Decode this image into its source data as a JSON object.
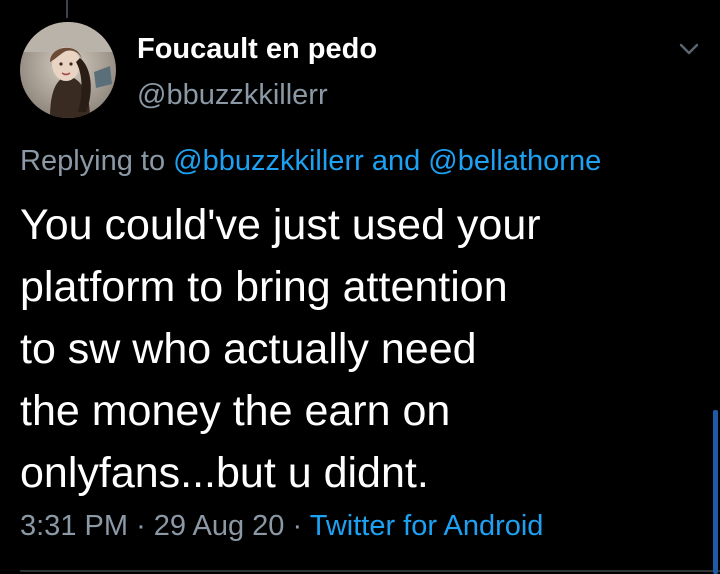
{
  "author": {
    "display_name": "Foucault en pedo",
    "handle": "@bbuzzkkillerr",
    "avatar": "profile-photo"
  },
  "menu_icon": "chevron-down-icon",
  "reply_context": {
    "prefix": "Replying to",
    "mention_1": "@bbuzzkkillerr",
    "joiner": "and",
    "mention_2": "@bellathorne"
  },
  "tweet": {
    "lines": [
      "You could've just used your",
      "platform to bring attention",
      "to sw who actually need",
      "the money the earn on",
      "onlyfans...but u didnt."
    ]
  },
  "meta": {
    "time": "3:31 PM",
    "separator": "·",
    "date": "29 Aug 20",
    "source": "Twitter for Android"
  },
  "colors": {
    "background": "#000000",
    "text": "#ffffff",
    "secondary": "#8b98a5",
    "link": "#1da1f2"
  }
}
